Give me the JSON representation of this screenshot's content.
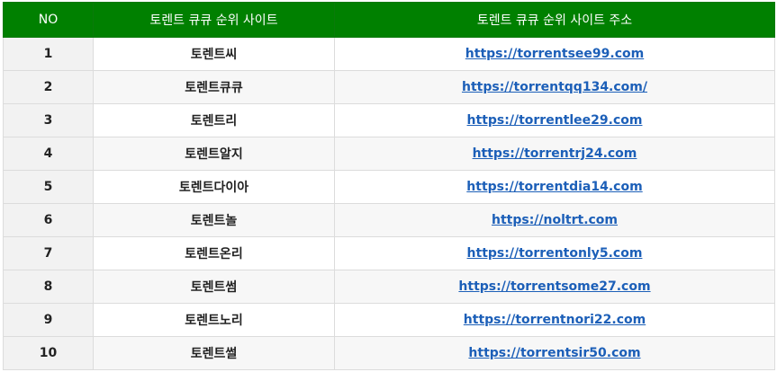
{
  "table": {
    "headers": {
      "no": "NO",
      "name": "토렌트 큐큐 순위 사이트",
      "url": "토렌트 큐큐 순위 사이트 주소"
    },
    "rows": [
      {
        "no": "1",
        "name": "토렌트씨",
        "url": "https://torrentsee99.com"
      },
      {
        "no": "2",
        "name": "토렌트큐큐",
        "url": "https://torrentqq134.com/"
      },
      {
        "no": "3",
        "name": "토렌트리",
        "url": "https://torrentlee29.com"
      },
      {
        "no": "4",
        "name": "토렌트알지",
        "url": "https://torrentrj24.com"
      },
      {
        "no": "5",
        "name": "토렌트다이아",
        "url": "https://torrentdia14.com"
      },
      {
        "no": "6",
        "name": "토렌트놀",
        "url": "https://noltrt.com"
      },
      {
        "no": "7",
        "name": "토렌트온리",
        "url": "https://torrentonly5.com"
      },
      {
        "no": "8",
        "name": "토렌트썸",
        "url": "https://torrentsome27.com"
      },
      {
        "no": "9",
        "name": "토렌트노리",
        "url": "https://torrentnori22.com"
      },
      {
        "no": "10",
        "name": "토렌트썰",
        "url": "https://torrentsir50.com"
      }
    ]
  },
  "colors": {
    "header_bg": "#008000",
    "header_text": "#ffffff",
    "link": "#1c5fb8"
  }
}
